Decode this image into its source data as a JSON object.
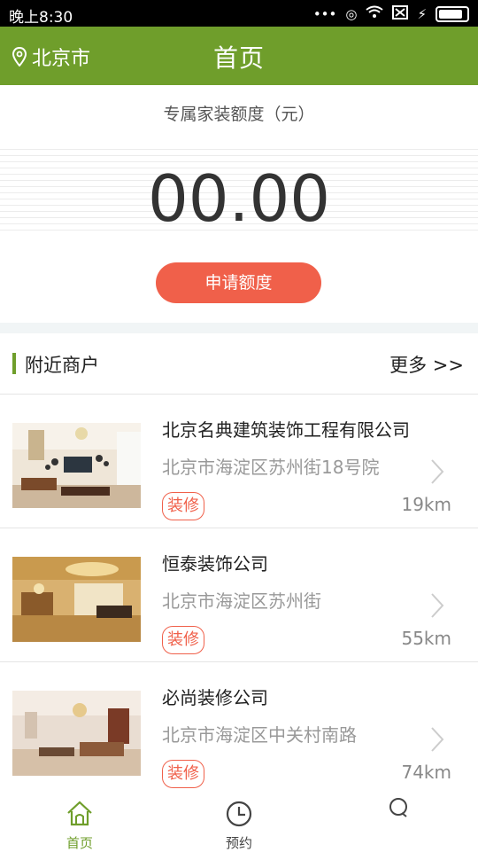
{
  "status_bar": {
    "time": "晚上8:30",
    "icons": [
      "signal-dots-icon",
      "location-icon",
      "wifi-icon",
      "sim-off-icon",
      "charging-icon",
      "battery-icon"
    ]
  },
  "header": {
    "location": "北京市",
    "title": "首页",
    "color": "#6f9e2b"
  },
  "quota": {
    "label": "专属家装额度（元）",
    "amount": "00.00",
    "apply_button": "申请额度",
    "button_color": "#f0604a"
  },
  "nearby": {
    "title": "附近商户",
    "more": "更多 >>",
    "merchants": [
      {
        "name": "北京名典建筑装饰工程有限公司",
        "address": "北京市海淀区苏州街18号院",
        "tag": "装修",
        "distance": "19km"
      },
      {
        "name": "恒泰装饰公司",
        "address": "北京市海淀区苏州街",
        "tag": "装修",
        "distance": "55km"
      },
      {
        "name": "必尚装修公司",
        "address": "北京市海淀区中关村南路",
        "tag": "装修",
        "distance": "74km"
      }
    ]
  },
  "tabbar": {
    "tabs": [
      {
        "label": "首页",
        "icon": "home-icon",
        "active": true
      },
      {
        "label": "预约",
        "icon": "clock-icon",
        "active": false
      },
      {
        "label": "",
        "icon": "chat-icon",
        "active": false
      }
    ],
    "active_color": "#6f9e2b"
  }
}
